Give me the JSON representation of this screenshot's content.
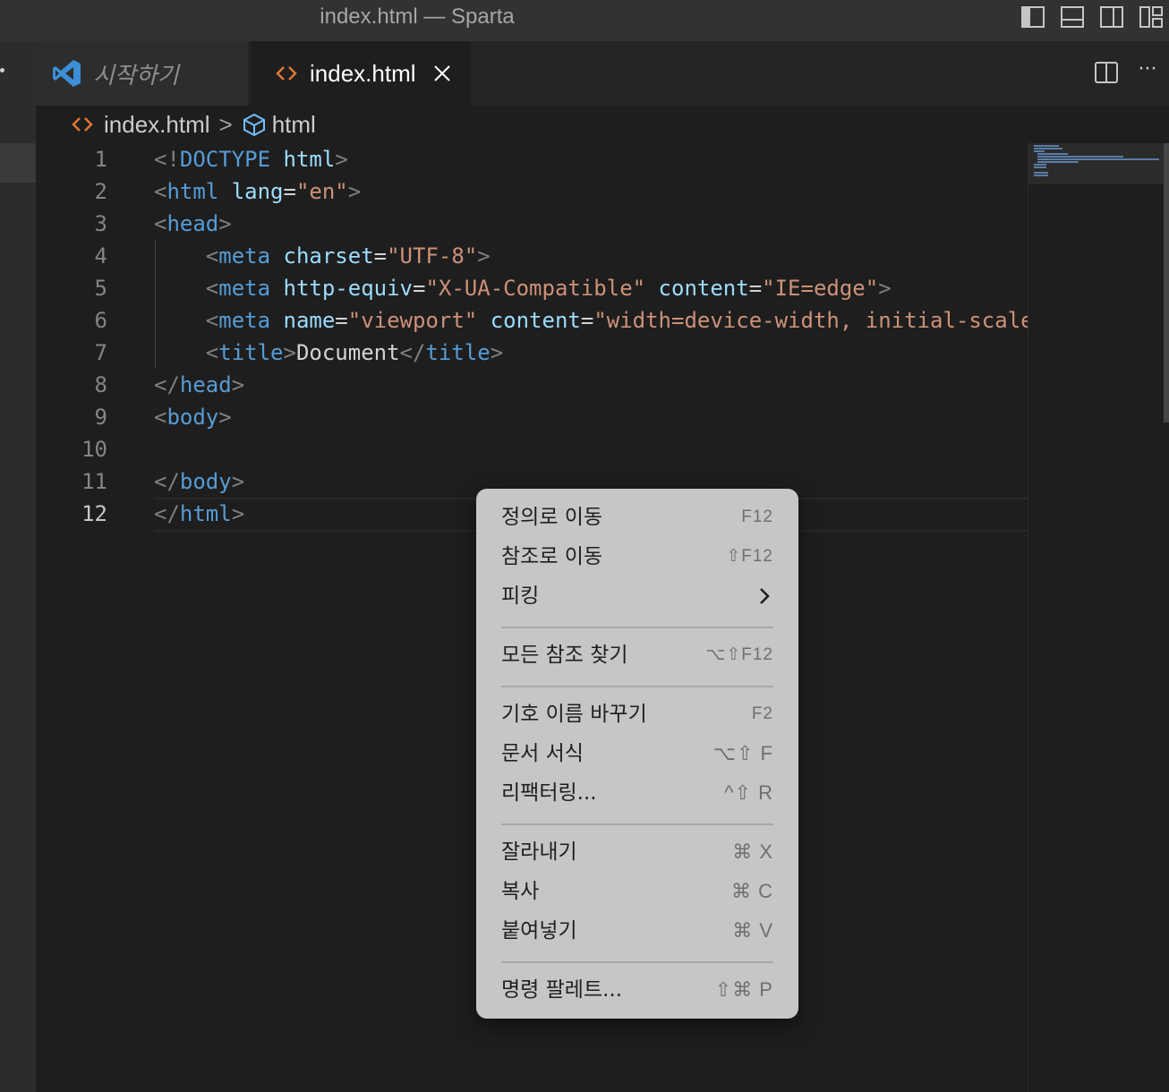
{
  "window": {
    "title": "index.html — Sparta"
  },
  "tabs": [
    {
      "label": "시작하기",
      "icon": "vscode-logo-icon",
      "active": false
    },
    {
      "label": "index.html",
      "icon": "html-brackets-icon",
      "active": true
    }
  ],
  "breadcrumb": {
    "file": "index.html",
    "separator": ">",
    "symbol": "html"
  },
  "editor": {
    "line_numbers": [
      "1",
      "2",
      "3",
      "4",
      "5",
      "6",
      "7",
      "8",
      "9",
      "10",
      "11",
      "12"
    ],
    "current_line": 12,
    "lines": [
      [
        [
          "punc",
          "<!"
        ],
        [
          "tag",
          "DOCTYPE"
        ],
        [
          "text",
          " "
        ],
        [
          "attr",
          "html"
        ],
        [
          "punc",
          ">"
        ]
      ],
      [
        [
          "punc",
          "<"
        ],
        [
          "tag",
          "html"
        ],
        [
          "text",
          " "
        ],
        [
          "attr",
          "lang"
        ],
        [
          "text",
          "="
        ],
        [
          "str",
          "\"en\""
        ],
        [
          "punc",
          ">"
        ]
      ],
      [
        [
          "punc",
          "<"
        ],
        [
          "tag",
          "head"
        ],
        [
          "punc",
          ">"
        ]
      ],
      [
        [
          "text",
          "    "
        ],
        [
          "punc",
          "<"
        ],
        [
          "tag",
          "meta"
        ],
        [
          "text",
          " "
        ],
        [
          "attr",
          "charset"
        ],
        [
          "text",
          "="
        ],
        [
          "str",
          "\"UTF-8\""
        ],
        [
          "punc",
          ">"
        ]
      ],
      [
        [
          "text",
          "    "
        ],
        [
          "punc",
          "<"
        ],
        [
          "tag",
          "meta"
        ],
        [
          "text",
          " "
        ],
        [
          "attr",
          "http-equiv"
        ],
        [
          "text",
          "="
        ],
        [
          "str",
          "\"X-UA-Compatible\""
        ],
        [
          "text",
          " "
        ],
        [
          "attr",
          "content"
        ],
        [
          "text",
          "="
        ],
        [
          "str",
          "\"IE=edge\""
        ],
        [
          "punc",
          ">"
        ]
      ],
      [
        [
          "text",
          "    "
        ],
        [
          "punc",
          "<"
        ],
        [
          "tag",
          "meta"
        ],
        [
          "text",
          " "
        ],
        [
          "attr",
          "name"
        ],
        [
          "text",
          "="
        ],
        [
          "str",
          "\"viewport\""
        ],
        [
          "text",
          " "
        ],
        [
          "attr",
          "content"
        ],
        [
          "text",
          "="
        ],
        [
          "str",
          "\"width=device-width, initial-scale"
        ]
      ],
      [
        [
          "text",
          "    "
        ],
        [
          "punc",
          "<"
        ],
        [
          "tag",
          "title"
        ],
        [
          "punc",
          ">"
        ],
        [
          "text",
          "Document"
        ],
        [
          "punc",
          "</"
        ],
        [
          "tag",
          "title"
        ],
        [
          "punc",
          ">"
        ]
      ],
      [
        [
          "punc",
          "</"
        ],
        [
          "tag",
          "head"
        ],
        [
          "punc",
          ">"
        ]
      ],
      [
        [
          "punc",
          "<"
        ],
        [
          "tag",
          "body"
        ],
        [
          "punc",
          ">"
        ]
      ],
      [],
      [
        [
          "punc",
          "</"
        ],
        [
          "tag",
          "body"
        ],
        [
          "punc",
          ">"
        ]
      ],
      [
        [
          "punc",
          "</"
        ],
        [
          "tag",
          "html"
        ],
        [
          "punc",
          ">"
        ]
      ]
    ]
  },
  "context_menu": {
    "groups": [
      [
        {
          "label": "정의로 이동",
          "shortcut": "F12",
          "small": true
        },
        {
          "label": "참조로 이동",
          "shortcut": "⇧F12",
          "small": true
        },
        {
          "label": "피킹",
          "submenu": true
        }
      ],
      [
        {
          "label": "모든 참조 찾기",
          "shortcut": "⌥⇧F12",
          "small": true
        }
      ],
      [
        {
          "label": "기호 이름 바꾸기",
          "shortcut": "F2",
          "small": true
        },
        {
          "label": "문서 서식",
          "shortcut": "⌥⇧ F"
        },
        {
          "label": "리팩터링...",
          "shortcut": "^⇧ R"
        }
      ],
      [
        {
          "label": "잘라내기",
          "shortcut": "⌘ X"
        },
        {
          "label": "복사",
          "shortcut": "⌘ C"
        },
        {
          "label": "붙여넣기",
          "shortcut": "⌘ V"
        }
      ],
      [
        {
          "label": "명령 팔레트...",
          "shortcut": "⇧⌘ P"
        }
      ]
    ]
  },
  "colors": {
    "tag": "#569cd6",
    "attribute": "#9cdcfe",
    "string": "#ce9178",
    "punctuation": "#808080",
    "html_icon": "#e37933",
    "vscode_blue": "#3c8fd6"
  }
}
